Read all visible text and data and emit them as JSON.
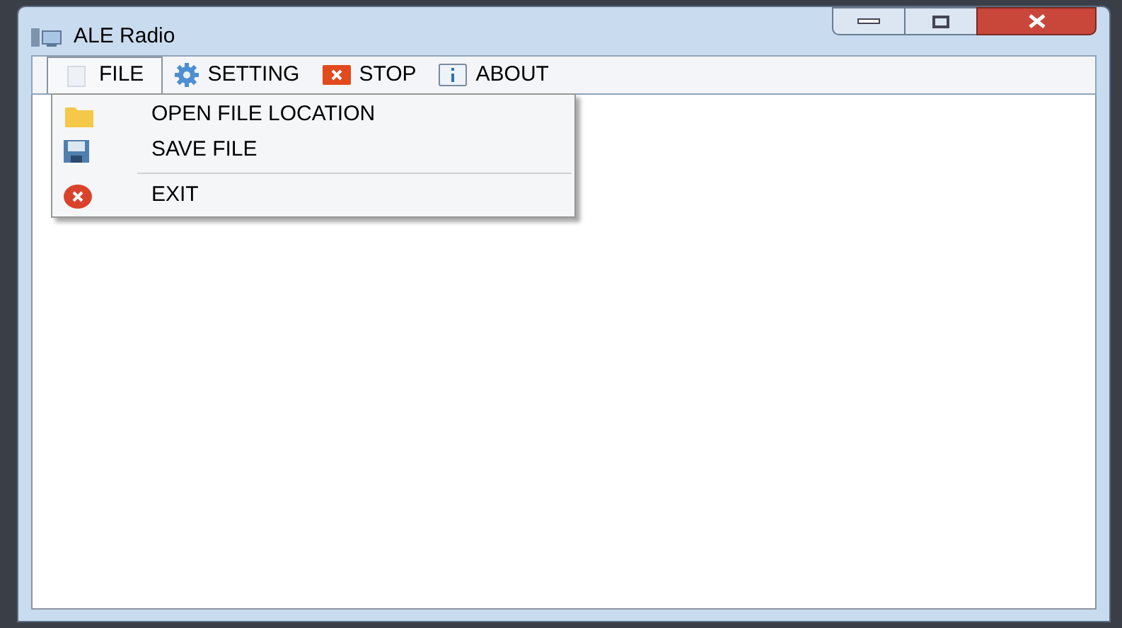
{
  "window": {
    "title": "ALE Radio"
  },
  "menu": [
    {
      "label": "FILE",
      "selected": true
    },
    {
      "label": "SETTING",
      "selected": false
    },
    {
      "label": "STOP",
      "selected": false
    },
    {
      "label": "ABOUT",
      "selected": false
    }
  ],
  "dropdown": [
    {
      "kind": "item",
      "label": "OPEN FILE LOCATION"
    },
    {
      "kind": "item",
      "label": "SAVE FILE"
    },
    {
      "kind": "separator"
    },
    {
      "kind": "item",
      "label": "EXIT"
    }
  ]
}
